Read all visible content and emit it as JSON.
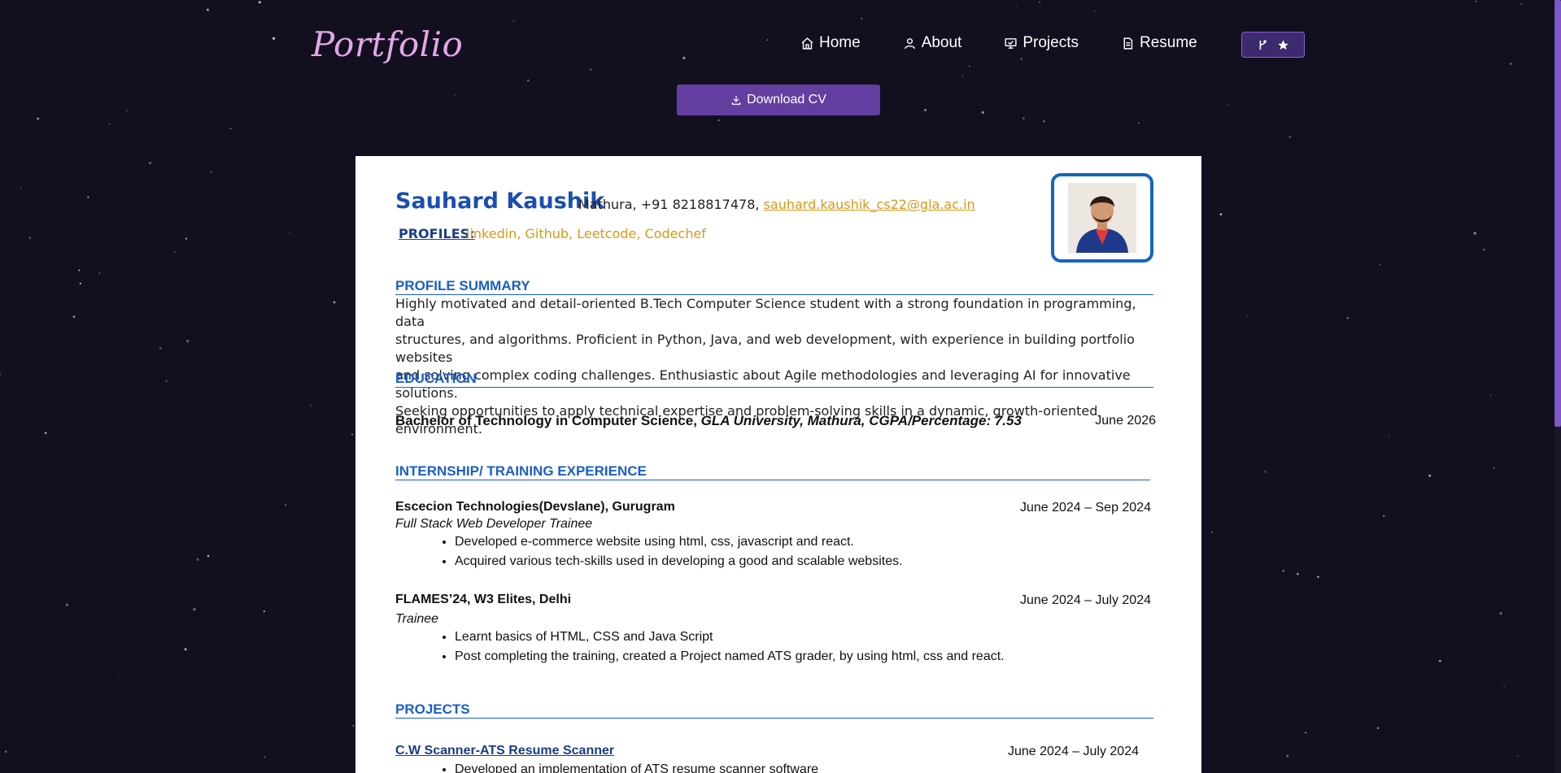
{
  "nav": {
    "logo": "Portfolio",
    "items": [
      {
        "label": "Home",
        "icon": "home-icon"
      },
      {
        "label": "About",
        "icon": "user-icon"
      },
      {
        "label": "Projects",
        "icon": "projects-icon"
      },
      {
        "label": "Resume",
        "icon": "document-icon"
      }
    ],
    "github_button": {
      "icons": [
        "fork-icon",
        "star-icon"
      ]
    }
  },
  "download": {
    "label": "Download CV",
    "icon": "download-icon"
  },
  "resume": {
    "name": "Sauhard Kaushik",
    "contact_prefix": "Mathura, +91 8218817478,",
    "email": "sauhard.kaushik_cs22@gla.ac.in",
    "profiles_label": "PROFILES:",
    "profiles_links": "linkedin, Github, Leetcode, Codechef",
    "summary_title": "PROFILE SUMMARY",
    "summary_lines": [
      "Highly motivated and detail-oriented B.Tech Computer Science student with a strong foundation in programming, data",
      "structures, and algorithms. Proficient in Python, Java, and web development, with experience in building portfolio websites",
      "and solving complex coding challenges. Enthusiastic about Agile methodologies and leveraging AI for innovative solutions.",
      "Seeking opportunities to apply technical expertise and problem-solving skills in a dynamic, growth-oriented environment."
    ],
    "education_title": "EDUCATION",
    "education": {
      "degree": "Bachelor of Technology in Computer Science,",
      "school": "GLA University, Mathura, CGPA/Percentage: 7.53",
      "date": "June 2026"
    },
    "internship_title": "INTERNSHIP/ TRAINING EXPERIENCE",
    "internships": [
      {
        "org": "Escecion Technologies(Devslane), Gurugram",
        "date": "June 2024 – Sep 2024",
        "role": "Full Stack Web Developer Trainee",
        "bullets": [
          "Developed e-commerce website using html, css, javascript and react.",
          "Acquired various tech-skills used in developing a good and scalable websites."
        ]
      },
      {
        "org": "FLAMES’24, W3 Elites, Delhi",
        "date": "June 2024 – July 2024",
        "role": "Trainee",
        "bullets": [
          "Learnt basics of HTML, CSS and Java Script",
          "Post completing the training, created a Project named ATS grader, by using html, css and react."
        ]
      }
    ],
    "projects_title": "PROJECTS",
    "projects": [
      {
        "title": "C.W Scanner-ATS Resume Scanner",
        "date": "June 2024 – July 2024",
        "bullet": "Developed an implementation of ATS resume scanner software"
      }
    ]
  },
  "colors": {
    "background": "#120f1e",
    "accent": "#623fa0",
    "heading": "#1a5fc9",
    "link": "#d39a17"
  }
}
